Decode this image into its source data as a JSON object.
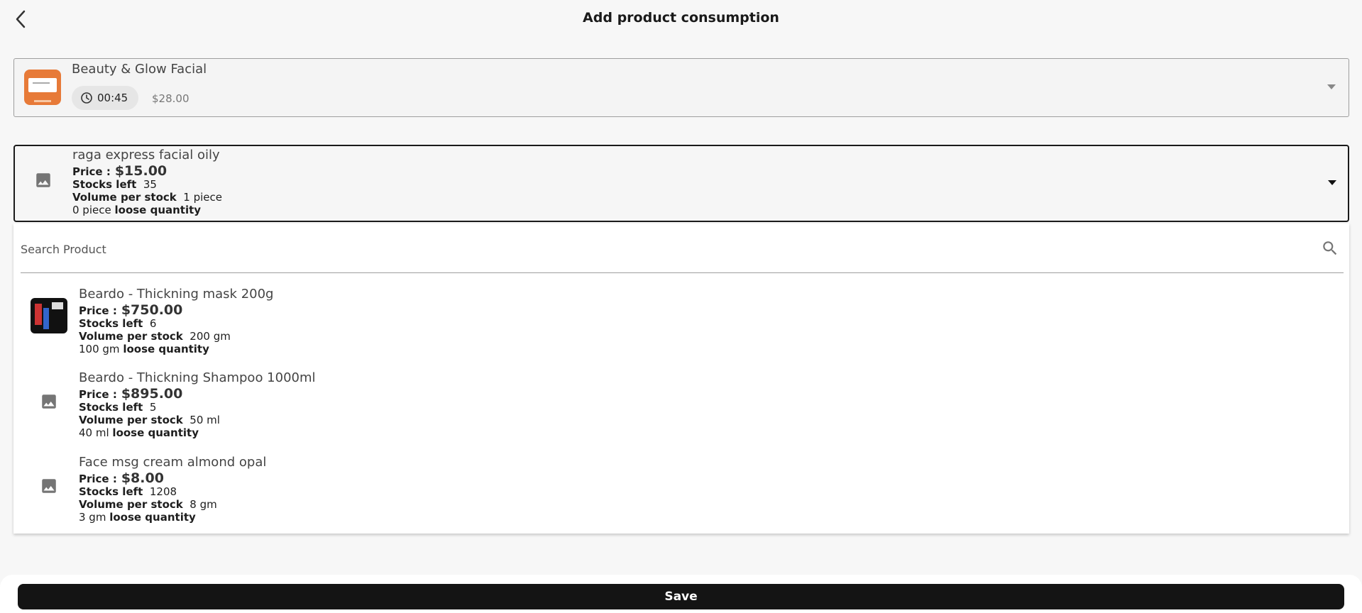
{
  "header": {
    "title": "Add product consumption",
    "back_icon": "chevron-left-icon"
  },
  "service": {
    "name": "Beauty & Glow Facial",
    "duration": "00:45",
    "price": "$28.00"
  },
  "selected_product": {
    "name": "raga express facial oily",
    "price_label": "Price :",
    "price": "$15.00",
    "stocks_label": "Stocks left",
    "stocks": "35",
    "volume_label": "Volume per stock",
    "volume": "1 piece",
    "loose_value": "0 piece",
    "loose_label": "loose quantity"
  },
  "search": {
    "placeholder": "Search Product"
  },
  "products": [
    {
      "name": "Beardo - Thickning mask 200g",
      "price_label": "Price :",
      "price": "$750.00",
      "stocks_label": "Stocks left",
      "stocks": "6",
      "volume_label": "Volume per stock",
      "volume": "200 gm",
      "loose_value": "100 gm",
      "loose_label": "loose quantity",
      "has_image": true
    },
    {
      "name": "Beardo - Thickning Shampoo 1000ml",
      "price_label": "Price :",
      "price": "$895.00",
      "stocks_label": "Stocks left",
      "stocks": "5",
      "volume_label": "Volume per stock",
      "volume": "50 ml",
      "loose_value": "40 ml",
      "loose_label": "loose quantity",
      "has_image": false
    },
    {
      "name": "Face msg cream almond opal",
      "price_label": "Price :",
      "price": "$8.00",
      "stocks_label": "Stocks left",
      "stocks": "1208",
      "volume_label": "Volume per stock",
      "volume": "8 gm",
      "loose_value": "3 gm",
      "loose_label": "loose quantity",
      "has_image": false
    }
  ],
  "footer": {
    "save_label": "Save"
  },
  "colors": {
    "background": "#f7f7f7",
    "button": "#141414",
    "service_thumb": "#e77a38"
  }
}
